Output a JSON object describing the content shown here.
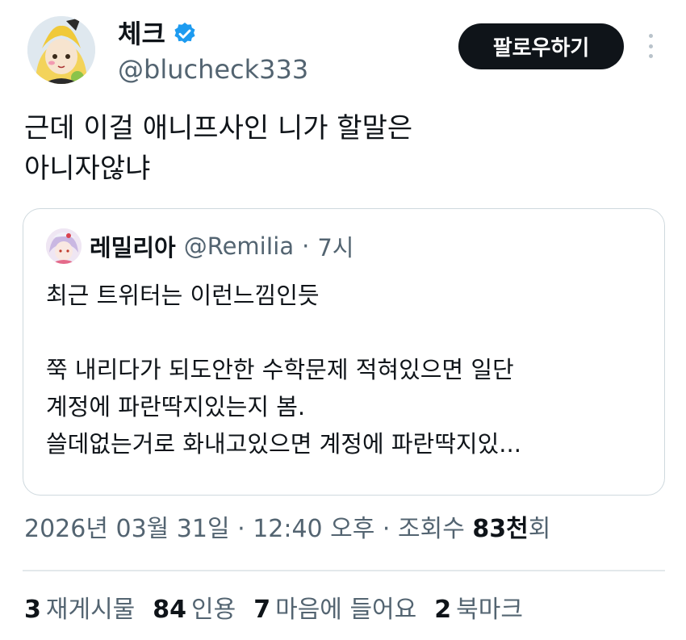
{
  "author": {
    "display_name": "체크",
    "handle": "@blucheck333",
    "verified_icon": "verified-badge-icon",
    "accent_color": "#1d9bf0"
  },
  "actions": {
    "follow_label": "팔로우하기",
    "more_icon": "more-vertical-icon"
  },
  "tweet": {
    "lines": [
      "근데 이걸 애니프사인 니가 할말은",
      "아니자않냐"
    ]
  },
  "quote": {
    "display_name": "레밀리아",
    "handle": "@RemiIia",
    "separator": "·",
    "time": "7시",
    "lines": [
      "최근 트위터는 이런느낌인듯",
      "",
      "쭉 내리다가 되도안한 수학문제 적혀있으면 일단",
      "계정에 파란딱지있는지 봄.",
      "쓸데없는거로 화내고있으면 계정에 파란딱지있..."
    ]
  },
  "meta": {
    "date": "2026년 03월 31일",
    "sep1": " · ",
    "time": "12:40 오후",
    "sep2": " · ",
    "views_label": "조회수 ",
    "views_count": "83천",
    "views_suffix": "회"
  },
  "stats": [
    {
      "count": "3",
      "label": "재게시물"
    },
    {
      "count": "84",
      "label": "인용"
    },
    {
      "count": "7",
      "label": "마음에 들어요"
    },
    {
      "count": "2",
      "label": "북마크"
    }
  ]
}
